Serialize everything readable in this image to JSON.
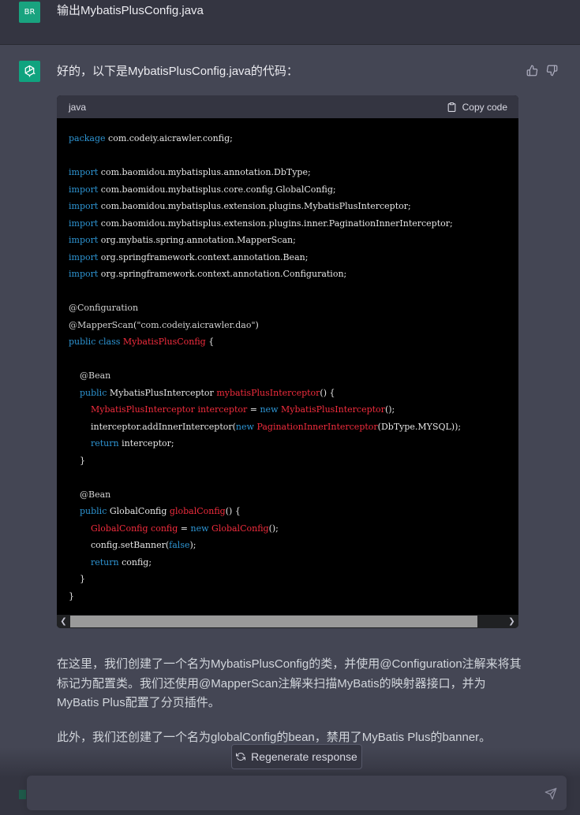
{
  "user_message": {
    "avatar_text": "BR",
    "text": "输出MybatisPlusConfig.java"
  },
  "assistant": {
    "intro": "好的，以下是MybatisPlusConfig.java的代码：",
    "code_block": {
      "language": "java",
      "copy_label": "Copy code"
    },
    "paragraphs": [
      "在这里，我们创建了一个名为MybatisPlusConfig的类，并使用@Configuration注解来将其标记为配置类。我们还使用@MapperScan注解来扫描MyBatis的映射器接口，并为MyBatis Plus配置了分页插件。",
      "此外，我们还创建了一个名为globalConfig的bean，禁用了MyBatis Plus的banner。"
    ]
  },
  "composer": {
    "regenerate_label": "Regenerate response",
    "input_value": "",
    "input_placeholder": ""
  },
  "colors": {
    "page_bg": "#444654",
    "user_row_bg": "#343541",
    "user_avatar": "#19a37f",
    "assistant_avatar": "#10a37f",
    "keyword": "#2e95d3",
    "class_name": "#f22c3d"
  }
}
